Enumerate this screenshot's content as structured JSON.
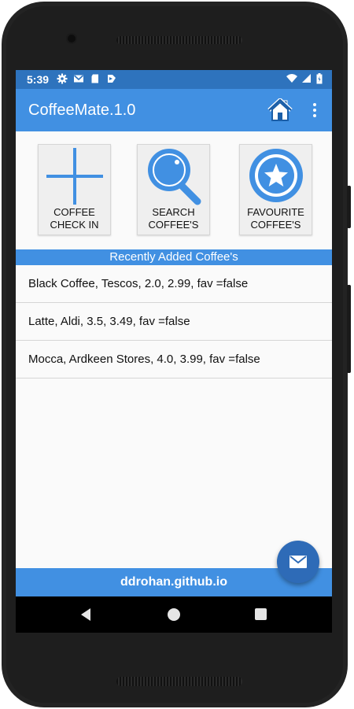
{
  "status_bar": {
    "time": "5:39",
    "icons_left": [
      "gear-icon",
      "gmail-icon",
      "sd-card-icon",
      "cast-icon"
    ],
    "icons_right": [
      "wifi-icon",
      "signal-icon",
      "battery-icon"
    ]
  },
  "app_bar": {
    "title": "CoffeeMate.1.0",
    "home_icon": "home-icon",
    "menu_icon": "more-vert-icon"
  },
  "tiles": [
    {
      "line1": "COFFEE",
      "line2": "CHECK IN",
      "icon": "plus-icon"
    },
    {
      "line1": "SEARCH",
      "line2": "COFFEE'S",
      "icon": "magnifier-icon"
    },
    {
      "line1": "FAVOURITE",
      "line2": "COFFEE'S",
      "icon": "star-icon"
    }
  ],
  "section_header": "Recently Added Coffee's",
  "coffee_list": [
    "Black Coffee, Tescos, 2.0, 2.99, fav =false",
    "Latte, Aldi, 3.5, 3.49, fav =false",
    "Mocca, Ardkeen Stores, 4.0, 3.99, fav =false"
  ],
  "footer": "ddrohan.github.io",
  "fab_icon": "mail-icon",
  "nav_bar": [
    "back-icon",
    "home-circle-icon",
    "recents-icon"
  ],
  "colors": {
    "primary": "#4190e2",
    "primary_dark": "#2e73bd",
    "fab": "#2e6bb7",
    "tile_bg": "#efefef"
  }
}
